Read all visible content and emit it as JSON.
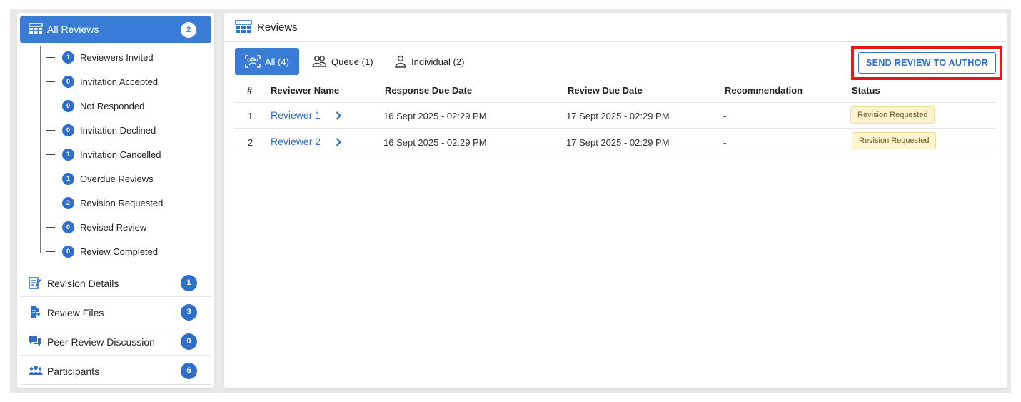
{
  "sidebar": {
    "header": {
      "label": "All Reviews",
      "count": "2"
    },
    "sub_items": [
      {
        "count": "1",
        "label": "Reviewers Invited"
      },
      {
        "count": "0",
        "label": "Invitation Accepted"
      },
      {
        "count": "0",
        "label": "Not Responded"
      },
      {
        "count": "0",
        "label": "Invitation Declined"
      },
      {
        "count": "1",
        "label": "Invitation Cancelled"
      },
      {
        "count": "1",
        "label": "Overdue Reviews"
      },
      {
        "count": "2",
        "label": "Revision Requested"
      },
      {
        "count": "0",
        "label": "Revised Review"
      },
      {
        "count": "0",
        "label": "Review Completed"
      }
    ],
    "sections": [
      {
        "label": "Revision Details",
        "count": "1",
        "icon": "edit-document-icon"
      },
      {
        "label": "Review Files",
        "count": "3",
        "icon": "file-arrow-icon"
      },
      {
        "label": "Peer Review Discussion",
        "count": "0",
        "icon": "chat-bubbles-icon"
      },
      {
        "label": "Participants",
        "count": "6",
        "icon": "people-group-icon"
      }
    ]
  },
  "main": {
    "title": "Reviews",
    "tabs": [
      {
        "label": "All (4)",
        "icon": "group-scan-icon",
        "active": true
      },
      {
        "label": "Queue (1)",
        "icon": "people-icon",
        "active": false
      },
      {
        "label": "Individual (2)",
        "icon": "person-icon",
        "active": false
      }
    ],
    "send_button": "SEND REVIEW TO AUTHOR",
    "columns": [
      "#",
      "Reviewer Name",
      "Response Due Date",
      "Review Due Date",
      "Recommendation",
      "Status"
    ],
    "rows": [
      {
        "num": "1",
        "name": "Reviewer 1",
        "response_due": "16 Sept 2025 - 02:29 PM",
        "review_due": "17 Sept 2025 - 02:29 PM",
        "recommendation": "-",
        "status": "Revision Requested"
      },
      {
        "num": "2",
        "name": "Reviewer 2",
        "response_due": "16 Sept 2025 - 02:29 PM",
        "review_due": "17 Sept 2025 - 02:29 PM",
        "recommendation": "-",
        "status": "Revision Requested"
      }
    ]
  },
  "colors": {
    "accent": "#3a7bd5",
    "highlight": "#e01b1b",
    "status_bg": "#fdf3cf"
  }
}
